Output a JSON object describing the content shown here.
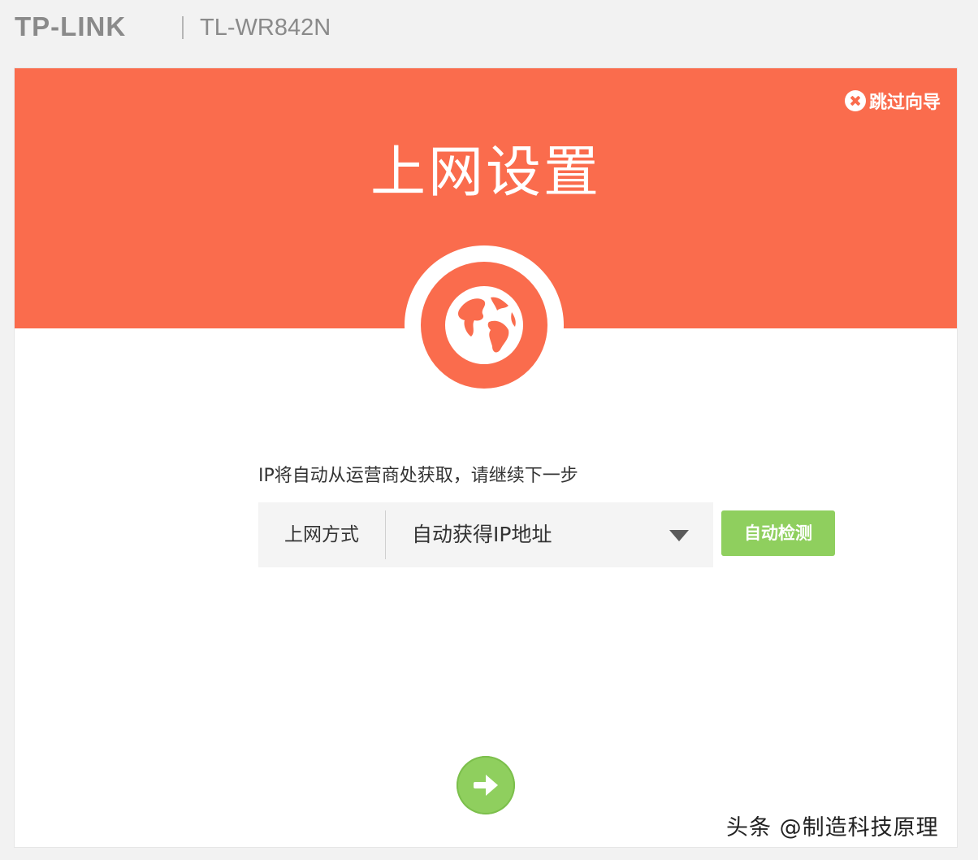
{
  "header": {
    "brand": "TP-LINK",
    "model": "TL-WR842N"
  },
  "banner": {
    "skip_label": "跳过向导",
    "title": "上网设置",
    "icon": "globe-icon"
  },
  "form": {
    "hint": "IP将自动从运营商处获取，请继续下一步",
    "connection_label": "上网方式",
    "connection_value": "自动获得IP地址",
    "detect_button": "自动检测"
  },
  "footer": {
    "next_icon": "arrow-right-icon"
  },
  "watermark": "头条 @制造科技原理",
  "colors": {
    "accent": "#fa6c4d",
    "button_green": "#8fcf5e"
  }
}
